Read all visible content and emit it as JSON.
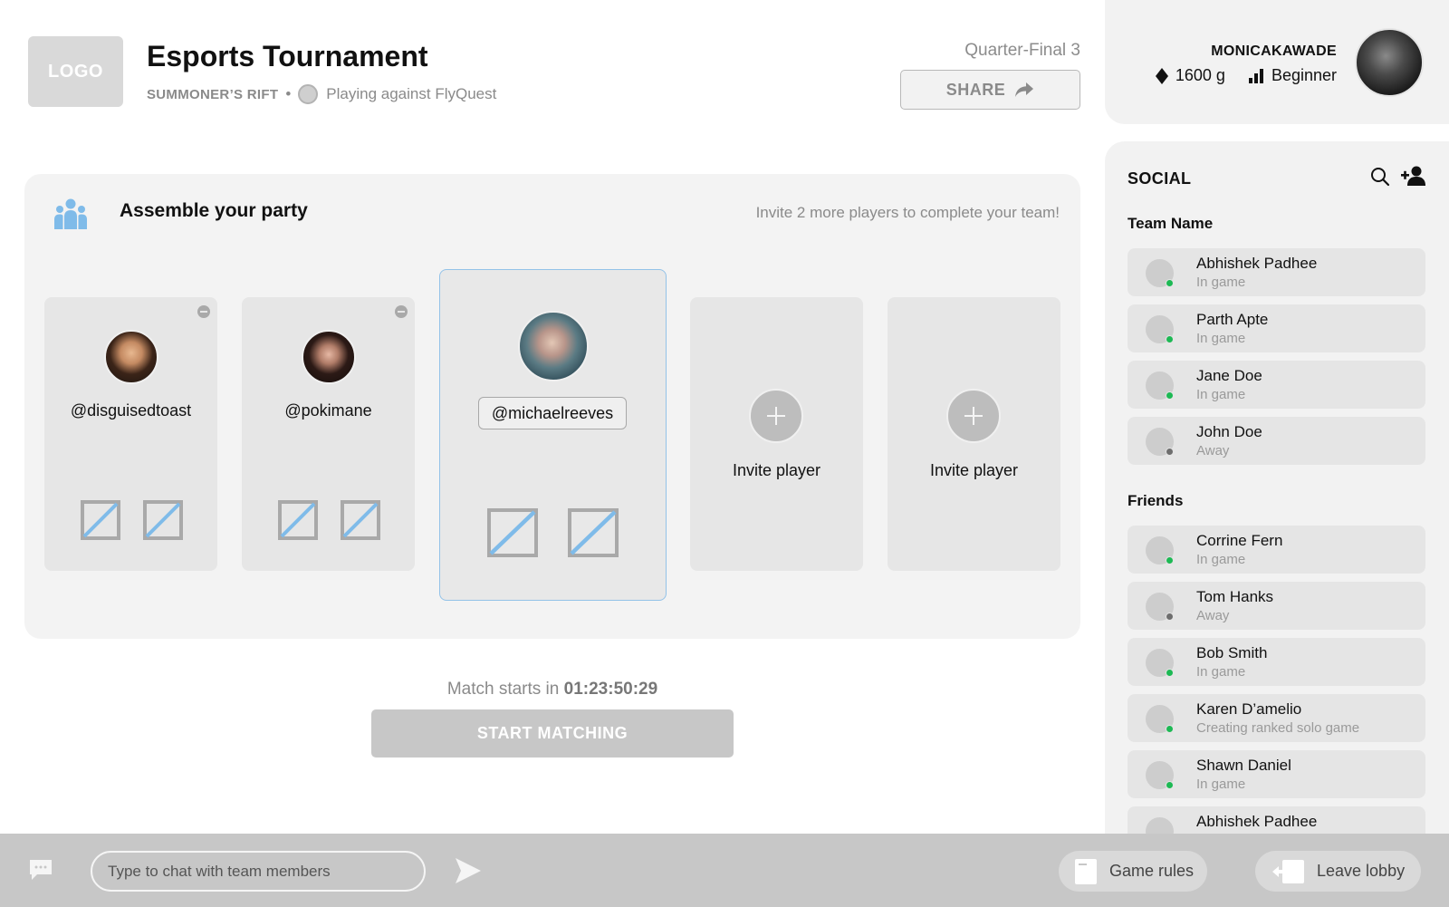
{
  "header": {
    "logo": "LOGO",
    "title": "Esports Tournament",
    "map": "SUMMONER’S RIFT",
    "separator": "•",
    "opponent_text": "Playing against FlyQuest",
    "match_label": "Quarter-Final 3",
    "share_label": "SHARE",
    "share_icon": "share-arrow-icon"
  },
  "profile": {
    "username": "MONICAKAWADE",
    "gold": "1600 g",
    "gold_icon": "diamond-icon",
    "rank": "Beginner",
    "rank_icon": "signal-bars-icon"
  },
  "social": {
    "title": "SOCIAL",
    "search_icon": "search-icon",
    "add_friend_icon": "add-friend-icon",
    "team_label": "Team Name",
    "team": [
      {
        "name": "Abhishek Padhee",
        "status": "In game",
        "presence": "online"
      },
      {
        "name": "Parth Apte",
        "status": "In game",
        "presence": "online"
      },
      {
        "name": "Jane Doe",
        "status": "In game",
        "presence": "online"
      },
      {
        "name": "John Doe",
        "status": "Away",
        "presence": "away"
      }
    ],
    "friends_label": "Friends",
    "friends": [
      {
        "name": "Corrine Fern",
        "status": "In game",
        "presence": "online"
      },
      {
        "name": "Tom Hanks",
        "status": "Away",
        "presence": "away"
      },
      {
        "name": "Bob Smith",
        "status": "In game",
        "presence": "online"
      },
      {
        "name": "Karen D’amelio",
        "status": "Creating ranked solo game",
        "presence": "online"
      },
      {
        "name": "Shawn Daniel",
        "status": "In game",
        "presence": "online"
      },
      {
        "name": "Abhishek Padhee",
        "status": "",
        "presence": "online"
      }
    ]
  },
  "party": {
    "icon": "people-icon",
    "title": "Assemble your party",
    "hint": "Invite 2 more players to complete your team!",
    "players": [
      {
        "handle": "@disguisedtoast"
      },
      {
        "handle": "@pokimane"
      },
      {
        "handle": "@michaelreeves"
      }
    ],
    "invite_label": "Invite player"
  },
  "match": {
    "starts_prefix": "Match starts in",
    "countdown": "01:23:50:29",
    "start_label": "START MATCHING"
  },
  "bottom": {
    "chat_placeholder": "Type to chat with team members",
    "rules_label": "Game rules",
    "leave_label": "Leave lobby"
  },
  "colors": {
    "online": "#1db954",
    "away": "#6e6e6e",
    "accent_blue": "#7fbbe9",
    "panel": "#f3f3f3"
  }
}
